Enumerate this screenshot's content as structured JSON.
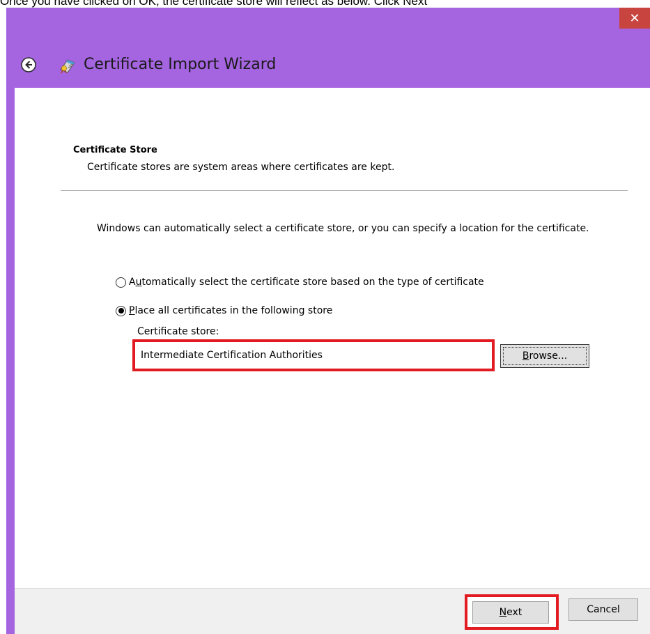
{
  "caption": "Once you have clicked on OK, the certificate store will reflect as below. Click Next",
  "window": {
    "title": "Certificate Import Wizard",
    "close_glyph": "✕",
    "colors": {
      "titlebar": "#a564e0",
      "close": "#c7443f",
      "highlight": "#e21b22"
    }
  },
  "section": {
    "title": "Certificate Store",
    "subtitle": "Certificate stores are system areas where certificates are kept."
  },
  "intro": "Windows can automatically select a certificate store, or you can specify a location for the certificate.",
  "options": [
    {
      "prefix": "A",
      "accel": "u",
      "rest": "tomatically select the certificate store based on the type of certificate",
      "selected": false
    },
    {
      "prefix": "",
      "accel": "P",
      "rest": "lace all certificates in the following store",
      "selected": true
    }
  ],
  "store": {
    "label": "Certificate store:",
    "value": "Intermediate Certification Authorities"
  },
  "buttons": {
    "browse_accel": "B",
    "browse_rest": "rowse...",
    "next_accel": "N",
    "next_rest": "ext",
    "cancel": "Cancel"
  },
  "icons": {
    "back": "back-arrow-icon",
    "wizard": "certificate-wizard-icon"
  }
}
